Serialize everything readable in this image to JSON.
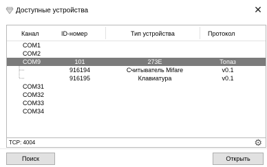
{
  "window": {
    "title": "Доступные устройства",
    "close_symbol": "✕"
  },
  "table": {
    "headers": {
      "channel": "Канал",
      "id": "ID-номер",
      "type": "Тип устройства",
      "protocol": "Протокол"
    },
    "rows": [
      {
        "channel": "COM1",
        "id": "",
        "type": "",
        "protocol": ""
      },
      {
        "channel": "COM2",
        "id": "",
        "type": "",
        "protocol": ""
      },
      {
        "channel": "COM9",
        "id": "101",
        "type": "273E",
        "protocol": "Топаз",
        "selected": true
      },
      {
        "channel": "",
        "id": "916194",
        "type": "Считыватель Mifare",
        "protocol": "v0.1",
        "child": true
      },
      {
        "channel": "",
        "id": "916195",
        "type": "Клавиатура",
        "protocol": "v0.1",
        "child": true,
        "last": true
      },
      {
        "channel": "COM31",
        "id": "",
        "type": "",
        "protocol": ""
      },
      {
        "channel": "COM32",
        "id": "",
        "type": "",
        "protocol": ""
      },
      {
        "channel": "COM33",
        "id": "",
        "type": "",
        "protocol": ""
      },
      {
        "channel": "COM34",
        "id": "",
        "type": "",
        "protocol": ""
      }
    ]
  },
  "status": {
    "text": "TCP: 4004",
    "settings_icon": "gear-icon"
  },
  "buttons": {
    "search": "Поиск",
    "open": "Открыть"
  },
  "colors": {
    "selected_row": "#7b7b7b",
    "button_bg": "#e1e1e1"
  }
}
